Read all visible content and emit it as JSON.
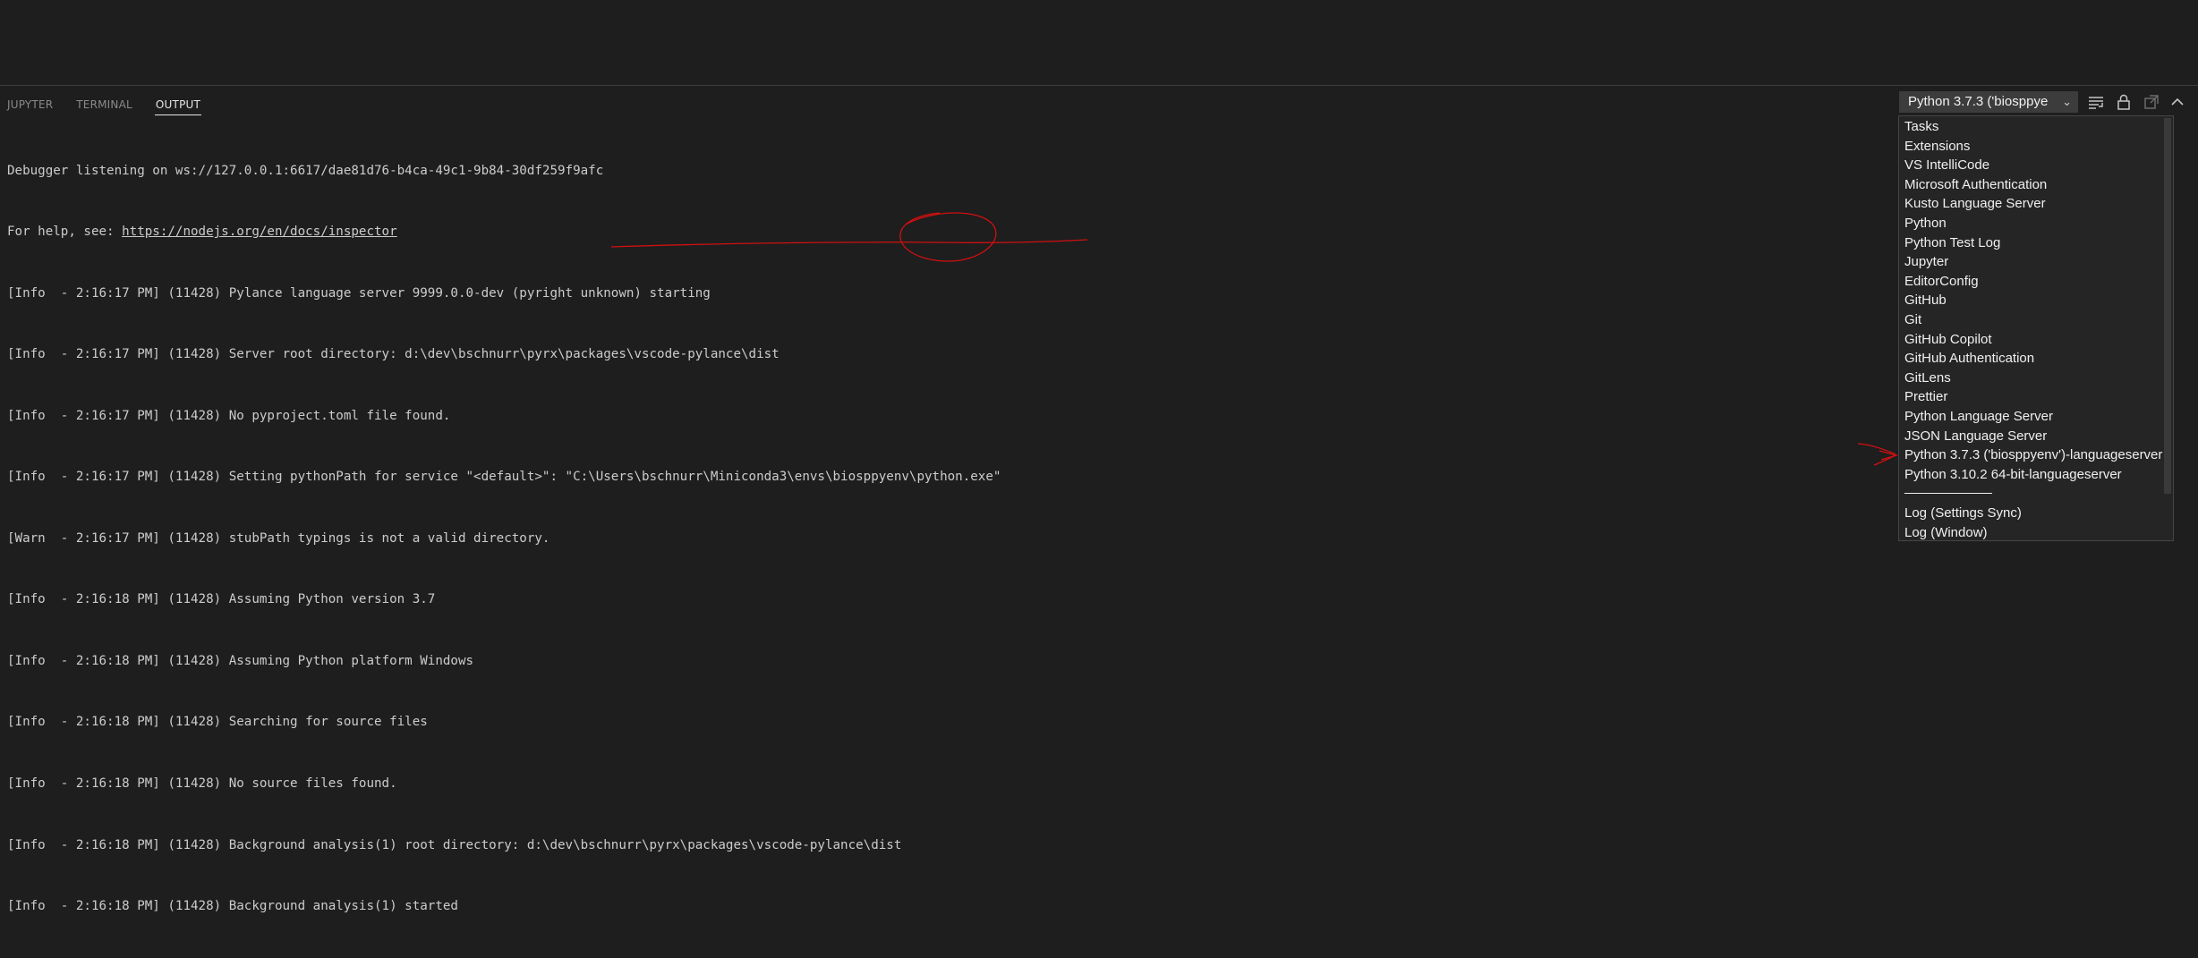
{
  "tabs": [
    {
      "label": "JUPYTER",
      "active": false
    },
    {
      "label": "TERMINAL",
      "active": false
    },
    {
      "label": "OUTPUT",
      "active": true
    }
  ],
  "output": {
    "line0": "Debugger listening on ws://127.0.0.1:6617/dae81d76-b4ca-49c1-9b84-30df259f9afc",
    "line1_prefix": "For help, see: ",
    "line1_link": "https://nodejs.org/en/docs/inspector",
    "lines": [
      "[Info  - 2:16:17 PM] (11428) Pylance language server 9999.0.0-dev (pyright unknown) starting",
      "[Info  - 2:16:17 PM] (11428) Server root directory: d:\\dev\\bschnurr\\pyrx\\packages\\vscode-pylance\\dist",
      "[Info  - 2:16:17 PM] (11428) No pyproject.toml file found."
    ],
    "pythonpath_prefix": "[Info  - 2:16:17 PM] (11428) Setting pythonPath for service \"<default>\": ",
    "pythonpath_value": "\"C:\\Users\\bschnurr\\Miniconda3\\envs\\biosppyenv\\python.exe\"",
    "lines_after": [
      "[Warn  - 2:16:17 PM] (11428) stubPath typings is not a valid directory.",
      "[Info  - 2:16:18 PM] (11428) Assuming Python version 3.7",
      "[Info  - 2:16:18 PM] (11428) Assuming Python platform Windows",
      "[Info  - 2:16:18 PM] (11428) Searching for source files",
      "[Info  - 2:16:18 PM] (11428) No source files found.",
      "[Info  - 2:16:18 PM] (11428) Background analysis(1) root directory: d:\\dev\\bschnurr\\pyrx\\packages\\vscode-pylance\\dist",
      "[Info  - 2:16:18 PM] (11428) Background analysis(1) started"
    ]
  },
  "toolbar": {
    "channel_selected": "Python 3.7.3 ('biosppye",
    "icons": [
      "clear-output-icon",
      "lock-icon",
      "open-editor-icon",
      "chevron-up-icon"
    ]
  },
  "dropdown": {
    "options": [
      "Tasks",
      "Extensions",
      "VS IntelliCode",
      "Microsoft Authentication",
      "Kusto Language Server",
      "Python",
      "Python Test Log",
      "Jupyter",
      "EditorConfig",
      "GitHub",
      "Git",
      "GitHub Copilot",
      "GitHub Authentication",
      "GitLens",
      "Prettier",
      "Python Language Server",
      "JSON Language Server",
      "Python 3.7.3 ('biosppyenv')-languageserver",
      "Python 3.10.2 64-bit-languageserver"
    ],
    "options_after_separator": [
      "Log (Settings Sync)",
      "Log (Window)"
    ]
  },
  "colors": {
    "background": "#1e1e1e",
    "text": "#cccccc",
    "annotation": "#d01010",
    "dropdown_bg": "#252526"
  }
}
